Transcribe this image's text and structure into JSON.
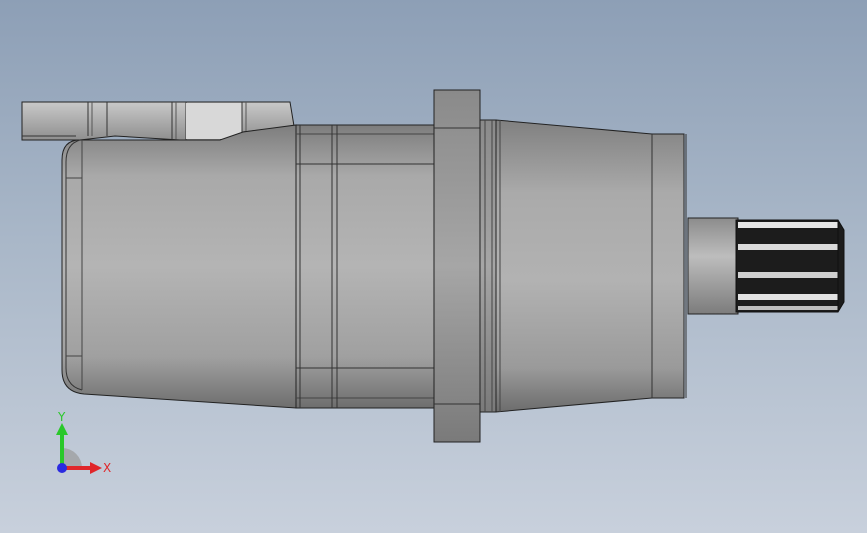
{
  "triad": {
    "x_label": "X",
    "y_label": "Y",
    "colors": {
      "x": "#e0262a",
      "y": "#2ac82a",
      "z": "#2a2ae0"
    }
  },
  "view": {
    "background_top": "#8d9fb6",
    "background_bottom": "#c8d0dc"
  }
}
